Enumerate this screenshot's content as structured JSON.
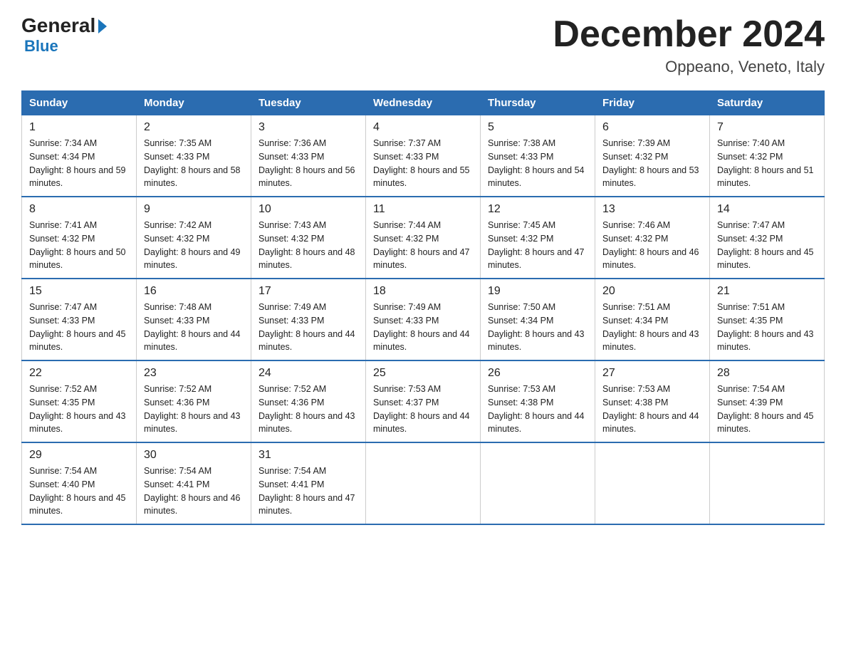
{
  "logo": {
    "general": "General",
    "blue": "Blue",
    "arrow": true
  },
  "title": "December 2024",
  "location": "Oppeano, Veneto, Italy",
  "days_of_week": [
    "Sunday",
    "Monday",
    "Tuesday",
    "Wednesday",
    "Thursday",
    "Friday",
    "Saturday"
  ],
  "weeks": [
    [
      {
        "day": "1",
        "sunrise": "7:34 AM",
        "sunset": "4:34 PM",
        "daylight": "8 hours and 59 minutes."
      },
      {
        "day": "2",
        "sunrise": "7:35 AM",
        "sunset": "4:33 PM",
        "daylight": "8 hours and 58 minutes."
      },
      {
        "day": "3",
        "sunrise": "7:36 AM",
        "sunset": "4:33 PM",
        "daylight": "8 hours and 56 minutes."
      },
      {
        "day": "4",
        "sunrise": "7:37 AM",
        "sunset": "4:33 PM",
        "daylight": "8 hours and 55 minutes."
      },
      {
        "day": "5",
        "sunrise": "7:38 AM",
        "sunset": "4:33 PM",
        "daylight": "8 hours and 54 minutes."
      },
      {
        "day": "6",
        "sunrise": "7:39 AM",
        "sunset": "4:32 PM",
        "daylight": "8 hours and 53 minutes."
      },
      {
        "day": "7",
        "sunrise": "7:40 AM",
        "sunset": "4:32 PM",
        "daylight": "8 hours and 51 minutes."
      }
    ],
    [
      {
        "day": "8",
        "sunrise": "7:41 AM",
        "sunset": "4:32 PM",
        "daylight": "8 hours and 50 minutes."
      },
      {
        "day": "9",
        "sunrise": "7:42 AM",
        "sunset": "4:32 PM",
        "daylight": "8 hours and 49 minutes."
      },
      {
        "day": "10",
        "sunrise": "7:43 AM",
        "sunset": "4:32 PM",
        "daylight": "8 hours and 48 minutes."
      },
      {
        "day": "11",
        "sunrise": "7:44 AM",
        "sunset": "4:32 PM",
        "daylight": "8 hours and 47 minutes."
      },
      {
        "day": "12",
        "sunrise": "7:45 AM",
        "sunset": "4:32 PM",
        "daylight": "8 hours and 47 minutes."
      },
      {
        "day": "13",
        "sunrise": "7:46 AM",
        "sunset": "4:32 PM",
        "daylight": "8 hours and 46 minutes."
      },
      {
        "day": "14",
        "sunrise": "7:47 AM",
        "sunset": "4:32 PM",
        "daylight": "8 hours and 45 minutes."
      }
    ],
    [
      {
        "day": "15",
        "sunrise": "7:47 AM",
        "sunset": "4:33 PM",
        "daylight": "8 hours and 45 minutes."
      },
      {
        "day": "16",
        "sunrise": "7:48 AM",
        "sunset": "4:33 PM",
        "daylight": "8 hours and 44 minutes."
      },
      {
        "day": "17",
        "sunrise": "7:49 AM",
        "sunset": "4:33 PM",
        "daylight": "8 hours and 44 minutes."
      },
      {
        "day": "18",
        "sunrise": "7:49 AM",
        "sunset": "4:33 PM",
        "daylight": "8 hours and 44 minutes."
      },
      {
        "day": "19",
        "sunrise": "7:50 AM",
        "sunset": "4:34 PM",
        "daylight": "8 hours and 43 minutes."
      },
      {
        "day": "20",
        "sunrise": "7:51 AM",
        "sunset": "4:34 PM",
        "daylight": "8 hours and 43 minutes."
      },
      {
        "day": "21",
        "sunrise": "7:51 AM",
        "sunset": "4:35 PM",
        "daylight": "8 hours and 43 minutes."
      }
    ],
    [
      {
        "day": "22",
        "sunrise": "7:52 AM",
        "sunset": "4:35 PM",
        "daylight": "8 hours and 43 minutes."
      },
      {
        "day": "23",
        "sunrise": "7:52 AM",
        "sunset": "4:36 PM",
        "daylight": "8 hours and 43 minutes."
      },
      {
        "day": "24",
        "sunrise": "7:52 AM",
        "sunset": "4:36 PM",
        "daylight": "8 hours and 43 minutes."
      },
      {
        "day": "25",
        "sunrise": "7:53 AM",
        "sunset": "4:37 PM",
        "daylight": "8 hours and 44 minutes."
      },
      {
        "day": "26",
        "sunrise": "7:53 AM",
        "sunset": "4:38 PM",
        "daylight": "8 hours and 44 minutes."
      },
      {
        "day": "27",
        "sunrise": "7:53 AM",
        "sunset": "4:38 PM",
        "daylight": "8 hours and 44 minutes."
      },
      {
        "day": "28",
        "sunrise": "7:54 AM",
        "sunset": "4:39 PM",
        "daylight": "8 hours and 45 minutes."
      }
    ],
    [
      {
        "day": "29",
        "sunrise": "7:54 AM",
        "sunset": "4:40 PM",
        "daylight": "8 hours and 45 minutes."
      },
      {
        "day": "30",
        "sunrise": "7:54 AM",
        "sunset": "4:41 PM",
        "daylight": "8 hours and 46 minutes."
      },
      {
        "day": "31",
        "sunrise": "7:54 AM",
        "sunset": "4:41 PM",
        "daylight": "8 hours and 47 minutes."
      },
      null,
      null,
      null,
      null
    ]
  ],
  "labels": {
    "sunrise_prefix": "Sunrise: ",
    "sunset_prefix": "Sunset: ",
    "daylight_prefix": "Daylight: "
  }
}
